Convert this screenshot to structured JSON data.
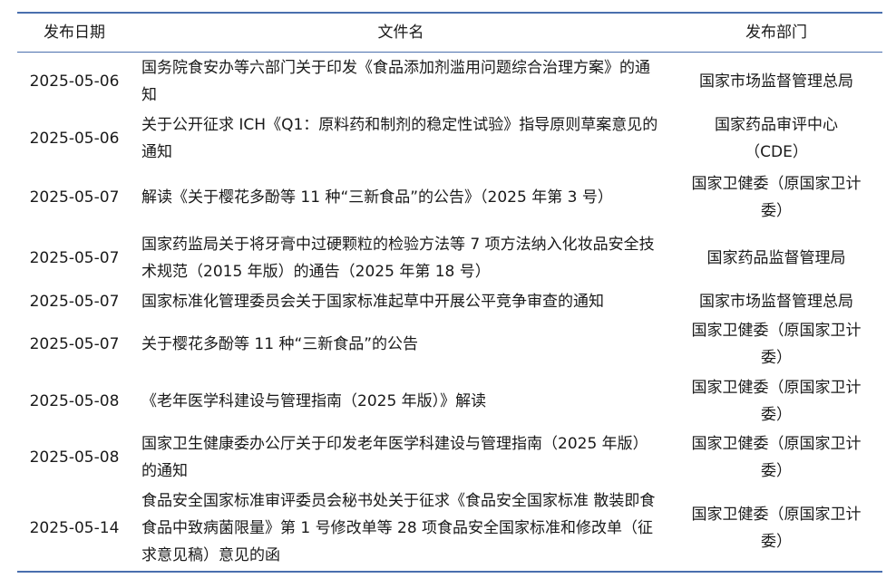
{
  "table": {
    "headers": {
      "date": "发布日期",
      "name": "文件名",
      "dept": "发布部门"
    },
    "rows": [
      {
        "date": "2025-05-06",
        "name": "国务院食安办等六部门关于印发《食品添加剂滥用问题综合治理方案》的通知",
        "dept": "国家市场监督管理总局"
      },
      {
        "date": "2025-05-06",
        "name": "关于公开征求 ICH《Q1：原料药和制剂的稳定性试验》指导原则草案意见的通知",
        "dept": "国家药品审评中心（CDE）"
      },
      {
        "date": "2025-05-07",
        "name": "解读《关于樱花多酚等 11 种“三新食品”的公告》（2025 年第 3 号）",
        "dept": "国家卫健委（原国家卫计委）"
      },
      {
        "date": "2025-05-07",
        "name": "国家药监局关于将牙膏中过硬颗粒的检验方法等 7 项方法纳入化妆品安全技术规范（2015 年版）的通告（2025 年第 18 号）",
        "dept": "国家药品监督管理局"
      },
      {
        "date": "2025-05-07",
        "name": "国家标准化管理委员会关于国家标准起草中开展公平竞争审查的通知",
        "dept": "国家市场监督管理总局"
      },
      {
        "date": "2025-05-07",
        "name": "关于樱花多酚等 11 种“三新食品”的公告",
        "dept": "国家卫健委（原国家卫计委）"
      },
      {
        "date": "2025-05-08",
        "name": "《老年医学科建设与管理指南（2025 年版）》解读",
        "dept": "国家卫健委（原国家卫计委）"
      },
      {
        "date": "2025-05-08",
        "name": "国家卫生健康委办公厅关于印发老年医学科建设与管理指南（2025 年版）的通知",
        "dept": "国家卫健委（原国家卫计委）"
      },
      {
        "date": "2025-05-14",
        "name": "食品安全国家标准审评委员会秘书处关于征求《食品安全国家标准 散装即食食品中致病菌限量》第 1 号修改单等 28 项食品安全国家标准和修改单（征求意见稿）意见的函",
        "dept": "国家卫健委（原国家卫计委）"
      }
    ]
  },
  "colors": {
    "rule": "#4a6fae",
    "text": "#1a1a1a"
  }
}
